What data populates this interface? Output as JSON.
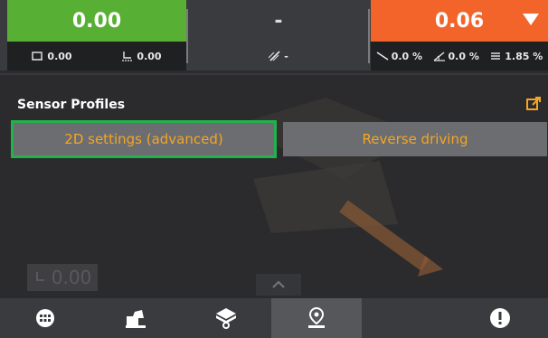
{
  "top": {
    "left_value": "0.00",
    "left_sub1": "0.00",
    "left_sub2": "0.00",
    "mid_value": "-",
    "mid_sub": "-",
    "right_value": "0.06",
    "right_sub1": "0.0 %",
    "right_sub2": "0.0 %",
    "right_sub3": "1.85 %",
    "colors": {
      "left": "#57b033",
      "right": "#f2642a"
    }
  },
  "sensor_profiles": {
    "title": "Sensor Profiles",
    "btn_2d": "2D settings (advanced)",
    "btn_reverse": "Reverse driving",
    "accent": "#f4a623",
    "selected_border": "#22b14c"
  },
  "faded_indicator": {
    "value": "0.00"
  },
  "nav": {
    "items": [
      "menu-icon",
      "machine-icon",
      "sensor-icon",
      "location-pin-icon",
      "blank",
      "alert-icon"
    ],
    "active_index": 3
  }
}
